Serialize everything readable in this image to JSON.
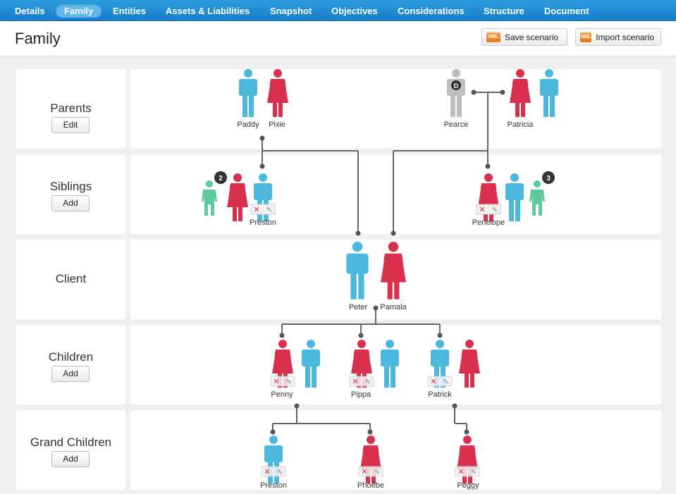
{
  "nav": {
    "items": [
      {
        "label": "Details",
        "active": false
      },
      {
        "label": "Family",
        "active": true
      },
      {
        "label": "Entities",
        "active": false
      },
      {
        "label": "Assets & Liabilities",
        "active": false
      },
      {
        "label": "Snapshot",
        "active": false
      },
      {
        "label": "Objectives",
        "active": false
      },
      {
        "label": "Considerations",
        "active": false
      },
      {
        "label": "Structure",
        "active": false
      },
      {
        "label": "Document",
        "active": false
      }
    ]
  },
  "header": {
    "title": "Family",
    "save_label": "Save scenario",
    "import_label": "Import scenario",
    "xml_icon_text": "XML"
  },
  "rows": [
    {
      "title": "Parents",
      "button": "Edit"
    },
    {
      "title": "Siblings",
      "button": "Add"
    },
    {
      "title": "Client",
      "button": ""
    },
    {
      "title": "Children",
      "button": "Add"
    },
    {
      "title": "Grand Children",
      "button": "Add"
    }
  ],
  "people": {
    "paddy": "Paddy",
    "pixie": "Pixie",
    "pearce": "Pearce",
    "pearce_badge": "D",
    "patricia": "Patricia",
    "preston_sibling": "Preston",
    "sibling_count_left": "2",
    "penelope": "Penelope",
    "sibling_count_right": "3",
    "peter": "Peter",
    "pamala": "Pamala",
    "penny": "Penny",
    "pippa": "Pippa",
    "patrick": "Patrick",
    "preston_grandchild": "Preston",
    "phoebe": "Phoebe",
    "peggy": "Peggy"
  },
  "colors": {
    "male": "#4cb8de",
    "female": "#d9304e",
    "deceased": "#bdbdbd",
    "child_generic": "#5ec99a",
    "nav": "#1c8ad4",
    "line": "#666666"
  }
}
